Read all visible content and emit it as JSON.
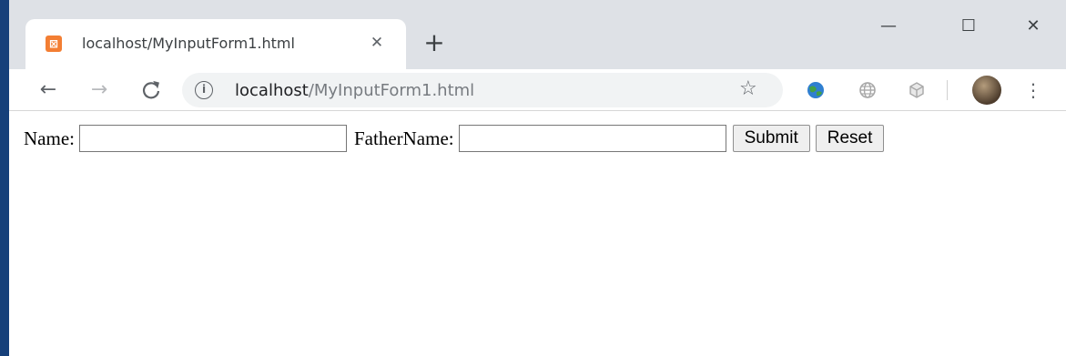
{
  "browser": {
    "tab": {
      "favicon_text": "⊠",
      "title": "localhost/MyInputForm1.html",
      "close_glyph": "✕"
    },
    "new_tab_glyph": "+",
    "window_controls": {
      "minimize": "—",
      "maximize": "☐",
      "close": "✕"
    },
    "toolbar": {
      "back_glyph": "←",
      "forward_glyph": "→",
      "reload_glyph": "C",
      "info_glyph": "i",
      "url_host": "localhost",
      "url_path": "/MyInputForm1.html",
      "star_glyph": "☆",
      "menu_glyph": "⋮"
    },
    "extensions": [
      "earth-extension-icon",
      "globe-extension-icon",
      "cube-extension-icon"
    ],
    "colors": {
      "tabstrip": "#dee1e6",
      "favicon": "#f37e33",
      "omnibox": "#f1f3f4"
    }
  },
  "form": {
    "name_label": "Name:",
    "name_value": "",
    "father_label": "FatherName:",
    "father_value": "",
    "submit_label": "Submit",
    "reset_label": "Reset"
  }
}
